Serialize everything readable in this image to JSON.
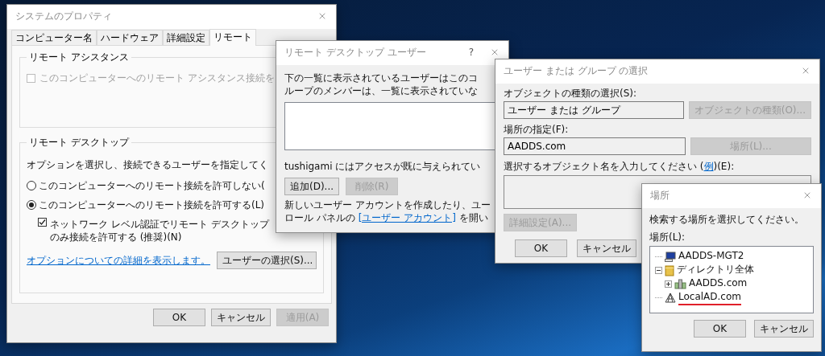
{
  "system_properties": {
    "title": "システムのプロパティ",
    "tabs": [
      {
        "label": "コンピューター名",
        "selected": false
      },
      {
        "label": "ハードウェア",
        "selected": false
      },
      {
        "label": "詳細設定",
        "selected": false
      },
      {
        "label": "リモート",
        "selected": true
      }
    ],
    "remote_assistance": {
      "title": "リモート アシスタンス",
      "checkbox": {
        "label": "このコンピューターへのリモート アシスタンス接続を",
        "checked": false,
        "disabled": true
      }
    },
    "remote_desktop": {
      "title": "リモート デスクトップ",
      "intro": "オプションを選択し、接続できるユーザーを指定してく",
      "options": [
        {
          "label": "このコンピューターへのリモート接続を許可しない(",
          "selected": false
        },
        {
          "label": "このコンピューターへのリモート接続を許可する(L)",
          "selected": true
        }
      ],
      "nla": {
        "lines": [
          "ネットワーク レベル認証でリモート デスクトップ",
          "のみ接続を許可する (推奨)(N)"
        ],
        "checked": true,
        "disabled": false
      },
      "help_link": "オプションについての詳細を表示します。",
      "select_users_button": "ユーザーの選択(S)..."
    },
    "buttons": [
      {
        "label": "OK",
        "disabled": false
      },
      {
        "label": "キャンセル",
        "disabled": false
      },
      {
        "label": "適用(A)",
        "disabled": true
      }
    ]
  },
  "remote_desktop_users": {
    "title": "リモート デスクトップ ユーザー",
    "help": "?",
    "intro_lines": [
      "下の一覧に表示されているユーザーはこのコ",
      "ループのメンバーは、一覧に表示されていな"
    ],
    "access_note": "tushigami にはアクセスが既に与えられてい",
    "buttons": [
      {
        "label": "追加(D)...",
        "disabled": false
      },
      {
        "label": "削除(R)",
        "disabled": true
      }
    ],
    "note": {
      "line1": "新しいユーザー アカウントを作成したり、ユー",
      "before": "ロール パネルの ",
      "link": "[ユーザー アカウント]",
      "after": " を開い"
    }
  },
  "select_users": {
    "title": "ユーザー または グループ の選択",
    "object_type": {
      "label": "オブジェクトの種類の選択(S):",
      "value": "ユーザー または グループ",
      "button": {
        "label": "オブジェクトの種類(O)...",
        "disabled": true
      }
    },
    "location": {
      "label": "場所の指定(F):",
      "value": "AADDS.com",
      "button": {
        "label": "場所(L)...",
        "disabled": true
      }
    },
    "names": {
      "before": "選択するオブジェクト名を入力してください (",
      "link": "例",
      "after": ")(E):"
    },
    "advanced_button": {
      "label": "詳細設定(A)...",
      "disabled": true
    },
    "buttons": [
      {
        "label": "OK",
        "disabled": false
      },
      {
        "label": "キャンセル",
        "disabled": false
      }
    ]
  },
  "locations": {
    "title": "場所",
    "prompt": "検索する場所を選択してください。",
    "tree_label": "場所(L):",
    "tree": [
      {
        "label": "AADDS-MGT2",
        "kind": "computer"
      },
      {
        "label": "ディレクトリ全体",
        "kind": "directory",
        "expanded": true,
        "children": [
          {
            "label": "AADDS.com",
            "kind": "domain",
            "expanded": false
          }
        ]
      },
      {
        "label": "LocalAD.com",
        "kind": "realm",
        "marked": true
      }
    ],
    "buttons": [
      {
        "label": "OK",
        "disabled": false
      },
      {
        "label": "キャンセル",
        "disabled": false
      }
    ]
  }
}
